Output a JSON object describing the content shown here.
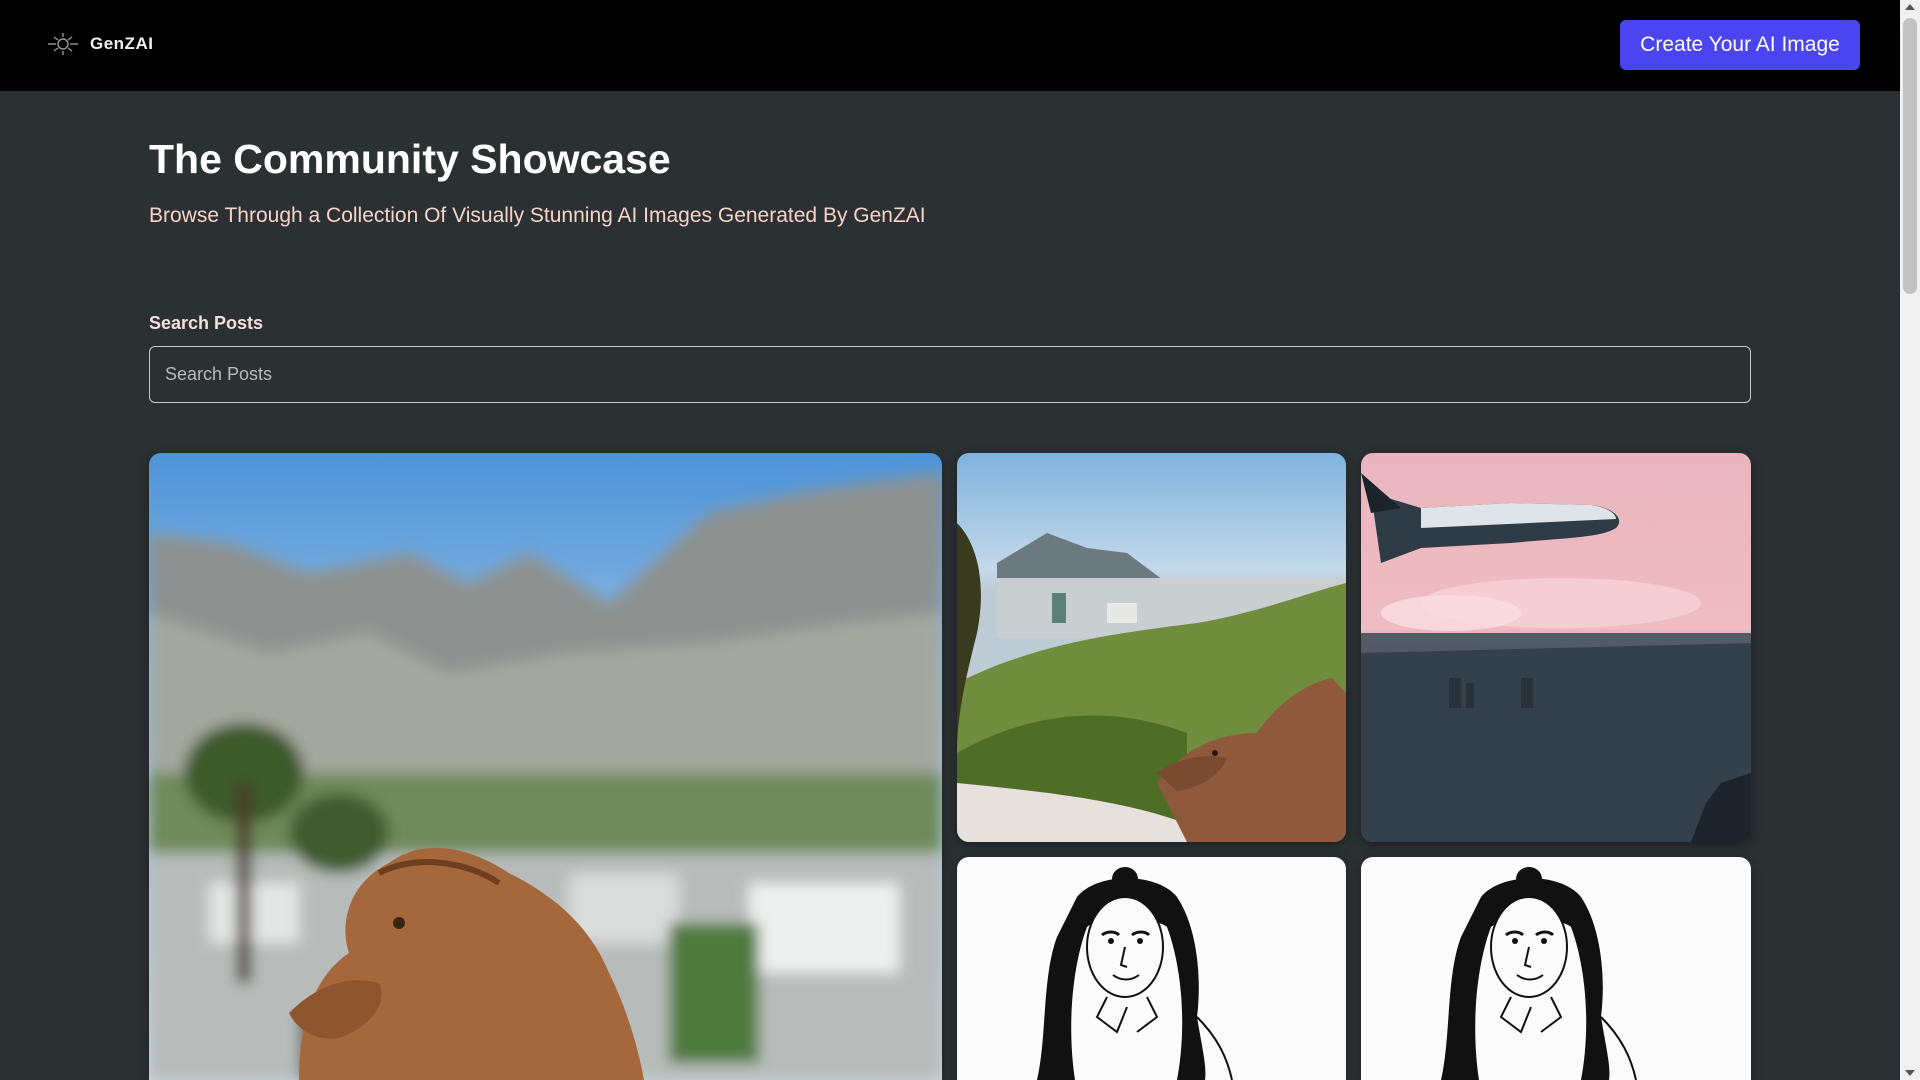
{
  "header": {
    "logo_text": "GenZAI",
    "cta_label": "Create Your AI Image"
  },
  "main": {
    "title": "The Community Showcase",
    "subtitle": "Browse Through a Collection Of Visually Stunning AI Images Generated By GenZAI",
    "search": {
      "label": "Search Posts",
      "placeholder": "Search Posts",
      "value": ""
    }
  },
  "gallery": {
    "items": [
      {
        "id": "post-1",
        "depicts": "dinosaur in front of mountain city"
      },
      {
        "id": "post-2",
        "depicts": "dinosaur overlooking coastal town"
      },
      {
        "id": "post-3",
        "depicts": "space shuttle over city at dusk"
      },
      {
        "id": "post-4",
        "depicts": "line drawing portrait"
      },
      {
        "id": "post-5",
        "depicts": "line drawing portrait"
      }
    ]
  },
  "colors": {
    "background": "#2b3033",
    "header": "#000000",
    "accent": "#4a45f0",
    "subtitle": "#f6d3c9"
  }
}
